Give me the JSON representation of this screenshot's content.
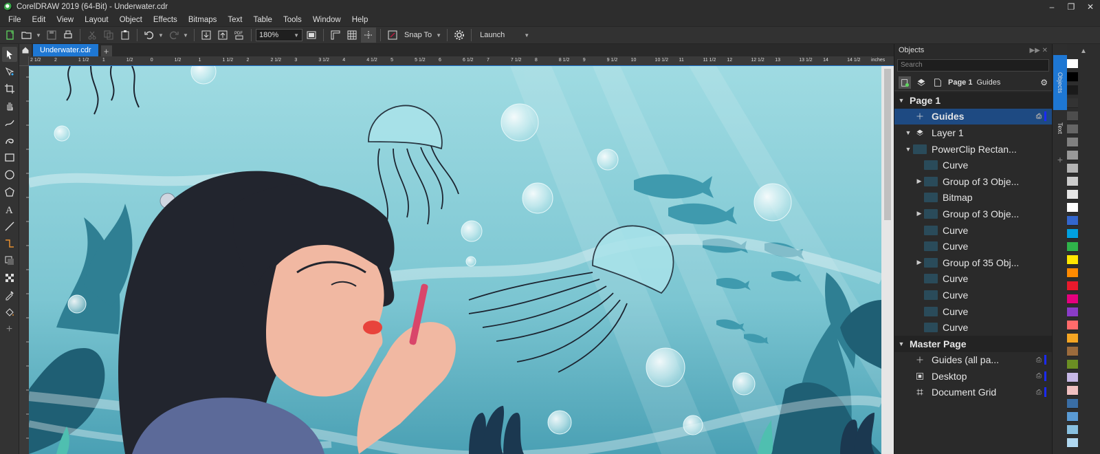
{
  "window": {
    "title": "CorelDRAW 2019 (64-Bit) - Underwater.cdr",
    "controls": [
      "–",
      "❐",
      "✕"
    ]
  },
  "menu": [
    "File",
    "Edit",
    "View",
    "Layout",
    "Object",
    "Effects",
    "Bitmaps",
    "Text",
    "Table",
    "Tools",
    "Window",
    "Help"
  ],
  "toolbar": {
    "zoom_value": "180%",
    "snap_to_label": "Snap To",
    "launch_label": "Launch"
  },
  "tabs": {
    "home_icon": "home-icon",
    "document_tab": "Underwater.cdr",
    "add_tab": "+"
  },
  "ruler": {
    "h_ticks": [
      "2 1/2",
      "2",
      "1 1/2",
      "1",
      "1/2",
      "0",
      "1/2",
      "1",
      "1 1/2",
      "2",
      "2 1/2",
      "3",
      "3 1/2",
      "4",
      "4 1/2",
      "5",
      "5 1/2",
      "6",
      "6 1/2",
      "7",
      "7 1/2",
      "8",
      "8 1/2",
      "9",
      "9 1/2",
      "10",
      "10 1/2",
      "11",
      "11 1/2",
      "12",
      "12 1/2",
      "13",
      "13 1/2",
      "14",
      "14 1/2",
      "inches"
    ]
  },
  "objects_panel": {
    "title": "Objects",
    "search_placeholder": "Search",
    "tab_page": "Page 1",
    "tab_guides": "Guides",
    "tree": [
      {
        "label": "Page 1",
        "kind": "section",
        "arrow": "▼"
      },
      {
        "label": "Guides",
        "kind": "selected",
        "icon": "guides-icon"
      },
      {
        "label": "Layer 1",
        "kind": "layer",
        "arrow": "▼",
        "icon": "layer-icon"
      },
      {
        "label": "PowerClip Rectan...",
        "kind": "item",
        "arrow": "▼",
        "indent": 1
      },
      {
        "label": "Curve",
        "kind": "item",
        "indent": 2
      },
      {
        "label": "Group of 3 Obje...",
        "kind": "item",
        "arrow": "▶",
        "indent": 2
      },
      {
        "label": "Bitmap",
        "kind": "item",
        "indent": 2
      },
      {
        "label": "Group of 3 Obje...",
        "kind": "item",
        "arrow": "▶",
        "indent": 2
      },
      {
        "label": "Curve",
        "kind": "item",
        "indent": 2
      },
      {
        "label": "Curve",
        "kind": "item",
        "indent": 2
      },
      {
        "label": "Group of 35 Obj...",
        "kind": "item",
        "arrow": "▶",
        "indent": 2
      },
      {
        "label": "Curve",
        "kind": "item",
        "indent": 2
      },
      {
        "label": "Curve",
        "kind": "item",
        "indent": 2
      },
      {
        "label": "Curve",
        "kind": "item",
        "indent": 2
      },
      {
        "label": "Curve",
        "kind": "item",
        "indent": 2
      },
      {
        "label": "Master Page",
        "kind": "section",
        "arrow": "▼"
      },
      {
        "label": "Guides (all pa...",
        "kind": "layer",
        "icon": "guides-icon"
      },
      {
        "label": "Desktop",
        "kind": "layer",
        "icon": "desktop-icon"
      },
      {
        "label": "Document Grid",
        "kind": "layer",
        "icon": "grid-icon"
      }
    ]
  },
  "side_tabs": {
    "objects": "Objects",
    "text": "Text"
  },
  "palette": {
    "colors": [
      "#ffffff",
      "#000000",
      "#1a1a1a",
      "#333333",
      "#4d4d4d",
      "#666666",
      "#808080",
      "#999999",
      "#b3b3b3",
      "#cccccc",
      "#e6e6e6",
      "#ffffff",
      "#3366cc",
      "#00a0e0",
      "#2fb34a",
      "#ffe600",
      "#ff8a00",
      "#e8192c",
      "#e6007e",
      "#8a3cc8",
      "#ff6b6b",
      "#f5a623",
      "#9b6b3c",
      "#6b8e23",
      "#c7b8e6",
      "#f0c0c0",
      "#3a6ea5",
      "#5a9bd5",
      "#88c0e0",
      "#b0d8f0"
    ]
  }
}
